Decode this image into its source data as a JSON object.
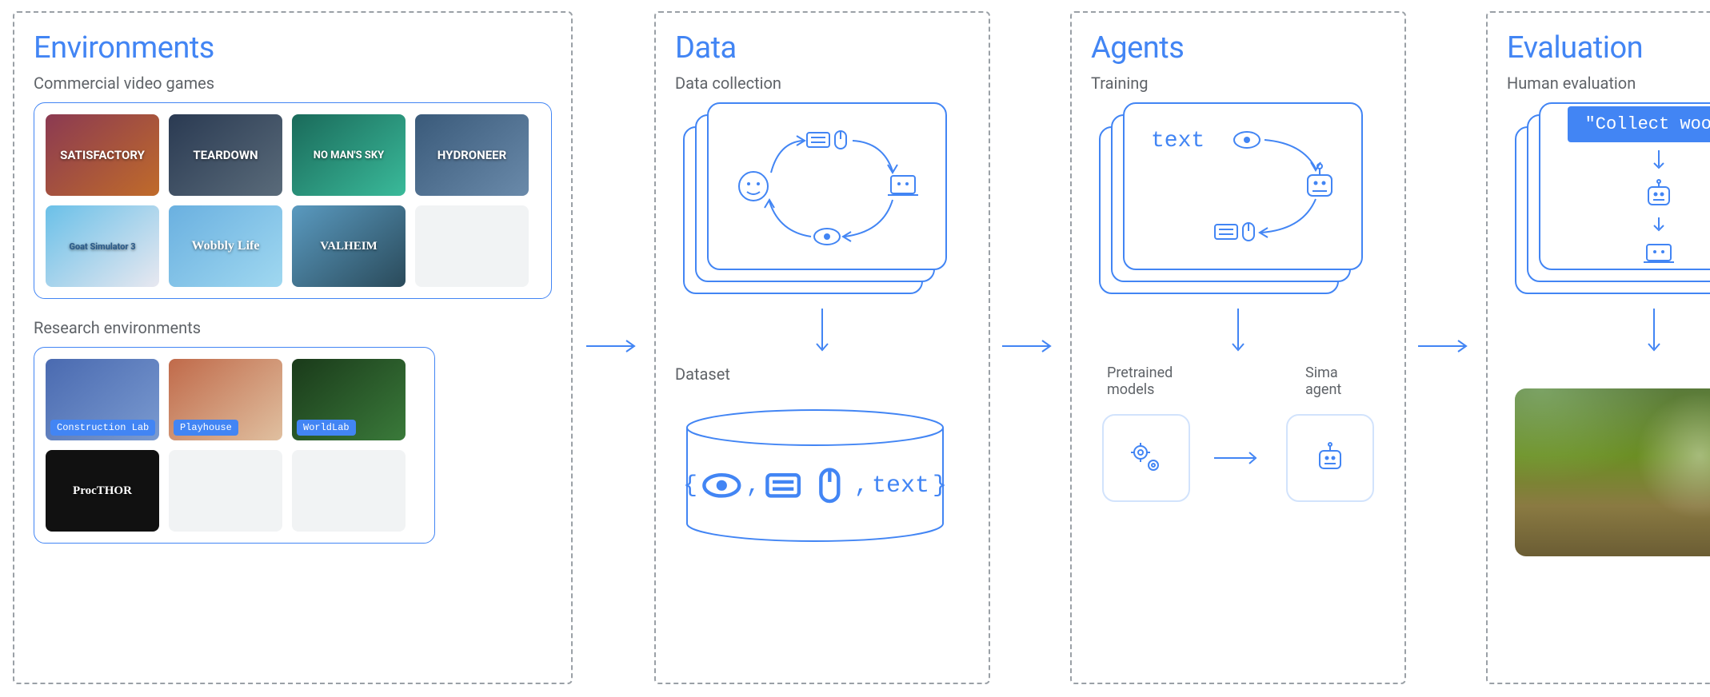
{
  "panels": {
    "environments": {
      "title": "Environments",
      "commercial_label": "Commercial video games",
      "research_label": "Research environments",
      "commercial_games": [
        "SATISFACTORY",
        "TEARDOWN",
        "NO MAN'S SKY",
        "HYDRONEER",
        "Goat Simulator 3",
        "Wobbly Life",
        "VALHEIM",
        ""
      ],
      "research_envs": [
        "Construction Lab",
        "Playhouse",
        "WorldLab",
        "ProcTHOR",
        "",
        ""
      ]
    },
    "data": {
      "title": "Data",
      "collection_label": "Data collection",
      "dataset_label": "Dataset",
      "dataset_contents": "text"
    },
    "agents": {
      "title": "Agents",
      "training_label": "Training",
      "text_label": "text",
      "pretrained_label": "Pretrained models",
      "sima_label": "Sima agent"
    },
    "evaluation": {
      "title": "Evaluation",
      "human_label": "Human evaluation",
      "task_text": "\"Collect wood\""
    }
  },
  "icons": {
    "person": "person-icon",
    "eye": "eye-icon",
    "keyboard": "keyboard-icon",
    "mouse": "mouse-icon",
    "gamepad": "gamepad-icon",
    "robot": "robot-icon",
    "gears": "gears-icon"
  }
}
